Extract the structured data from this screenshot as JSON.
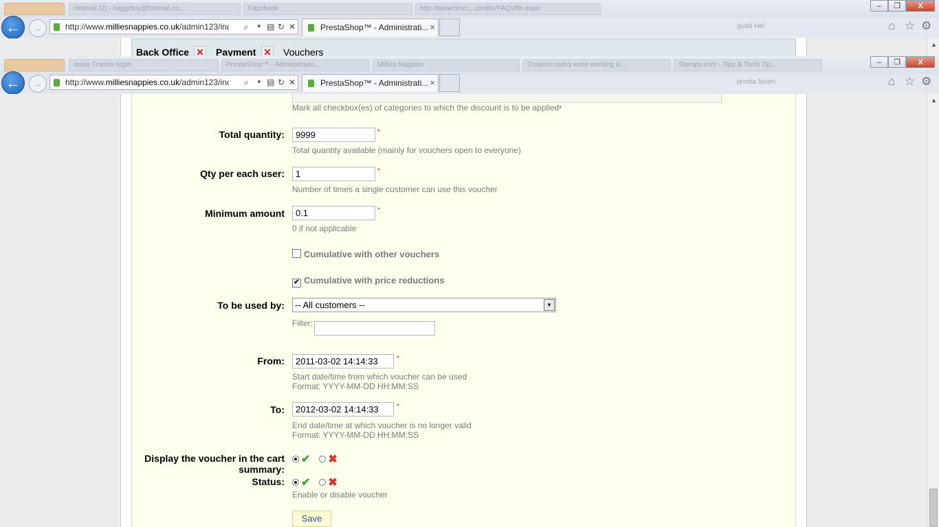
{
  "browser": {
    "window1": {
      "ghost_tabs": [
        "Hotmail (2) - higgyboy@hotmail.co...",
        "Facebook",
        "http://www.hmrc...credits/FAQs/fin.aspx"
      ],
      "url_prefix": "http://www.",
      "url_domain": "milliesnappies.co.uk",
      "url_path": "/admin123/indé",
      "tab_title": "PrestaShop™ - Administrati...",
      "tab_close": "×",
      "right_ghost": "gudd Hel"
    },
    "window2": {
      "ghost_tabs": [
        "Issue Tracker login",
        "PrestaShop™ - Administratio...",
        "Millies Nappies",
        "Coupon codes were working a...",
        "Stamps.com - Tips & Tools Tip..."
      ],
      "url_prefix": "http://www.",
      "url_domain": "milliesnappies.co.uk",
      "url_path": "/admin123/indé",
      "tab_title": "PrestaShop™ - Administrati...",
      "tab_close": "×",
      "right_ghost": "presta forum"
    },
    "window_buttons": {
      "min": "–",
      "max": "❐",
      "close": "X"
    }
  },
  "top_nav": {
    "items": [
      "Back Office",
      "Payment",
      "Vouchers"
    ],
    "close_mark": "✕"
  },
  "form": {
    "categories_hint": "Mark all checkbox(es) of categories to which the discount is to be applied",
    "required_mark": "*",
    "total_quantity": {
      "label": "Total quantity:",
      "value": "9999",
      "hint": "Total quantity available (mainly for vouchers open to everyone)"
    },
    "qty_per_user": {
      "label": "Qty per each user:",
      "value": "1",
      "hint": "Number of times a single customer can use this voucher"
    },
    "minimum_amount": {
      "label": "Minimum amount",
      "value": "0.1",
      "hint": "0 if not applicable"
    },
    "cumulative_vouchers": {
      "label": "Cumulative with other vouchers",
      "checked": false
    },
    "cumulative_reductions": {
      "label": "Cumulative with price reductions",
      "checked": true,
      "mark": "✔"
    },
    "to_be_used_by": {
      "label": "To be used by:",
      "value": "-- All customers --",
      "arrow": "▼",
      "filter_label": "Filter:",
      "filter_value": ""
    },
    "from": {
      "label": "From:",
      "value": "2011-03-02 14:14:33",
      "hint1": "Start date/time from which voucher can be used",
      "hint2": "Format: YYYY-MM-DD HH:MM:SS"
    },
    "to": {
      "label": "To:",
      "value": "2012-03-02 14:14:33",
      "hint1": "End date/time at which voucher is no longer valid",
      "hint2": "Format: YYYY-MM-DD HH:MM:SS"
    },
    "display_cart": {
      "label_line1": "Display the voucher in the cart",
      "label_line2": "summary:",
      "selected": "yes"
    },
    "status": {
      "label": "Status:",
      "hint": "Enable or disable voucher",
      "selected": "yes"
    },
    "yes_mark": "✔",
    "no_mark": "✖",
    "save_label": "Save"
  },
  "colors": {
    "panel_bg": "#ffffed",
    "required": "#e02020",
    "enabled_green": "#3aa33a",
    "disabled_red": "#e03030"
  }
}
